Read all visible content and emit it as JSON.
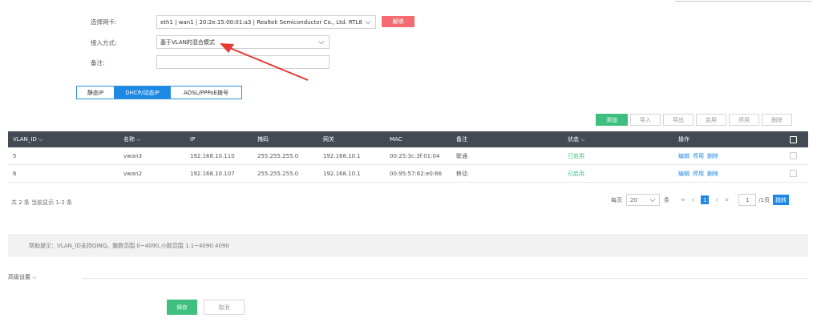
{
  "form": {
    "nic_label": "选择网卡:",
    "nic_value": "eth1 | wan1 | 20:2e:15:00:01:a3 | Realtek Semiconductor Co., Ltd. RTL8",
    "unbind_label": "解绑",
    "access_label": "接入方式:",
    "access_value": "基于VLAN的混合模式",
    "note_label": "备注:",
    "note_value": ""
  },
  "mode_tabs": [
    {
      "label": "静态IP",
      "active": false
    },
    {
      "label": "DHCP/动态IP",
      "active": true
    },
    {
      "label": "ADSL/PPPoE拨号",
      "active": false
    }
  ],
  "toolbar": {
    "add": "添加",
    "import": "导入",
    "export": "导出",
    "enable": "启用",
    "disable": "停用",
    "delete": "删除"
  },
  "table": {
    "headers": {
      "vlan_id": "VLAN_ID",
      "name": "名称",
      "ip": "IP",
      "mask": "掩码",
      "gateway": "网关",
      "mac": "MAC",
      "note": "备注",
      "status": "状态",
      "ops": "操作"
    },
    "rows": [
      {
        "vlan_id": "5",
        "name": "vwan3",
        "ip": "192.168.10.110",
        "mask": "255.255.255.0",
        "gateway": "192.168.10.1",
        "mac": "00:25:3c:3f:01:04",
        "note": "联通",
        "status": "已启用",
        "op_edit": "编辑",
        "op_disable": "停用",
        "op_delete": "删除"
      },
      {
        "vlan_id": "6",
        "name": "vwan2",
        "ip": "192.168.10.107",
        "mask": "255.255.255.0",
        "gateway": "192.168.10.1",
        "mac": "00:95:57:62:e0:66",
        "note": "移动",
        "status": "已启用",
        "op_edit": "编辑",
        "op_disable": "停用",
        "op_delete": "删除"
      }
    ]
  },
  "pagination": {
    "summary": "共 2 条 当前显示 1-2 条",
    "per_page_label": "每页",
    "per_page_value": "20",
    "unit_label": "条",
    "current_page": "1",
    "page_input": "1",
    "total_pages": "/1页",
    "goto_label": "跳转"
  },
  "hint": "帮助提示：VLAN_ID支持QINQ。整数范围 0~4090,小数范围 1.1~4090.4090",
  "advanced": "高级设置",
  "footer": {
    "save": "保存",
    "cancel": "取消"
  },
  "colors": {
    "primary": "#1e88e5",
    "success": "#3fbf7f",
    "danger": "#f46b72",
    "header_bg": "#434a54"
  }
}
